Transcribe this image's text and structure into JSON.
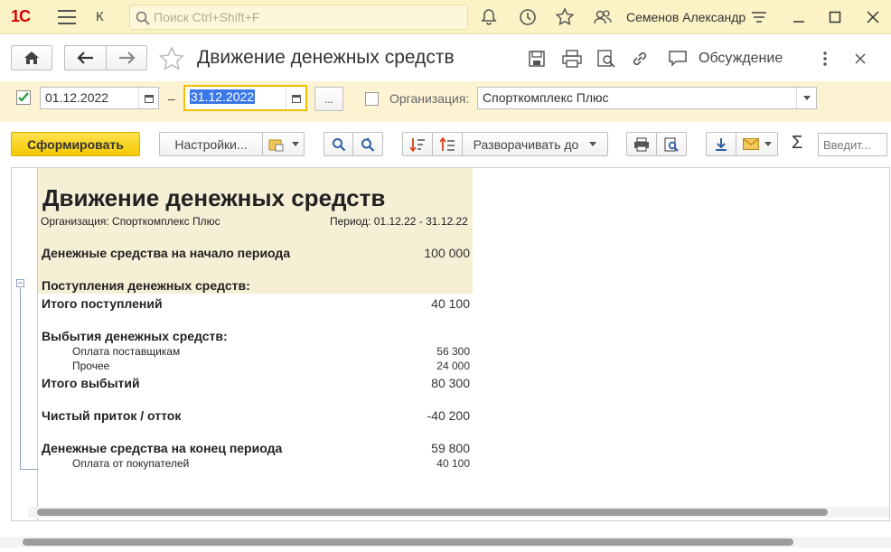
{
  "app": {
    "logo": "1С",
    "title": "К",
    "search_placeholder": "Поиск Ctrl+Shift+F",
    "user": "Семенов Александр"
  },
  "form": {
    "title": "Движение денежных средств",
    "discussion_label": "Обсуждение"
  },
  "params": {
    "date_from": "01.12.2022",
    "date_to": "31.12.2022",
    "dash": "–",
    "more_label": "...",
    "org_label": "Организация:",
    "org_value": "Спорткомплекс Плюс"
  },
  "toolbar": {
    "generate_label": "Сформировать",
    "settings_label": "Настройки...",
    "expand_label": "Разворачивать до",
    "input_placeholder": "Введит...",
    "sigma": "Σ"
  },
  "report": {
    "title": "Движение денежных средств",
    "org": "Организация: Спорткомплекс Плюс",
    "period": "Период: 01.12.22 - 31.12.22",
    "rows": [
      {
        "label": "Денежные средства на начало периода",
        "value": "100 000"
      },
      {
        "label": "Поступления денежных средств:",
        "value": ""
      },
      {
        "label": "Итого поступлений",
        "value": "40 100"
      },
      {
        "label": "Выбытия денежных средств:",
        "value": ""
      },
      {
        "label": "Оплата поставщикам",
        "value": "56 300"
      },
      {
        "label": "Прочее",
        "value": "24 000"
      },
      {
        "label": "Итого выбытий",
        "value": "80 300"
      },
      {
        "label": "Чистый приток / отток",
        "value": "-40 200"
      },
      {
        "label": "Денежные средства на конец периода",
        "value": "59 800"
      },
      {
        "label": "Оплата от покупателей",
        "value": "40 100"
      }
    ]
  },
  "colors": {
    "topbar": "#fbf3c6",
    "accent_button": "#f5c800",
    "report_header": "#f5efd6"
  }
}
